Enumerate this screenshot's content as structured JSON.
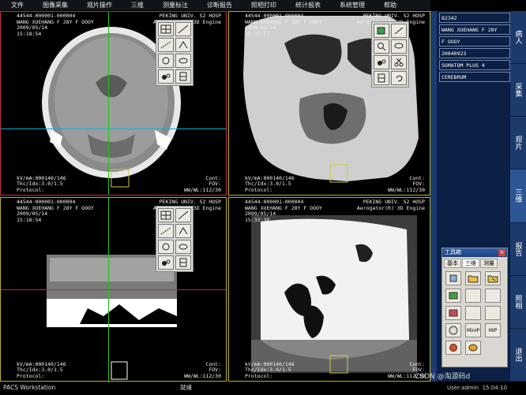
{
  "menu": [
    "文件",
    "图像采集",
    "观片操作",
    "三维",
    "测量标注",
    "诊断报告",
    "照相打印",
    "统计报表",
    "系统管理",
    "帮助"
  ],
  "viewports": [
    {
      "tl": "44544-000001-000004\nWANG XUEHANG F 28Y F OOOY\n2009/05/14\n15:18:54",
      "tr": "PEKING UNIV. S2 HOSP\nAerogator(R) 3D Engine",
      "bl": "kV/mA:000140/146\nThc/Idx:3.0/1.5\nProtocol:",
      "br": "Cont:\nFOV:\nWW/WL:112/30"
    },
    {
      "tl": "44544-000001-000004\nWANG XUEHANG F 28Y F OOOY\n2009/05/14\n15:33:57",
      "tr": "PEKING UNIV. S2 HOSP\nAerogator(R) 3D Engine",
      "bl": "kV/mA:000140/146\nThc/Idx:3.0/1.5\nProtocol:",
      "br": "Cont:\nFOV:\nWW/WL:112/30"
    },
    {
      "tl": "44544-000001-000004\nWANG XUEHANG F 28Y F OOOY\n2009/05/14\n15:18:54",
      "tr": "PEKING UNIV. S2 HOSP\nAerogator(R) 3D Engine",
      "bl": "kV/mA:000140/146\nThc/Idx:3.0/1.5\nProtocol:",
      "br": "Cont:\nFOV:\nWW/WL:112/30"
    },
    {
      "tl": "44544-000001-000004\nWANG XUEHANG F 28Y F OOOY\n2009/05/14\n15:33:38",
      "tr": "PEKING UNIV. S2 HOSP\nAerogator(R) 3D Engine",
      "bl": "kV/mA:000140/146\nThc/Idx:3.0/1.5\nProtocol:",
      "br": "Cont:\nFOV:\nWW/WL:112/30"
    }
  ],
  "patient_info": [
    "82342",
    "WANG XUEHANG F 28Y",
    "F OOOY",
    "20040923",
    "SOMATOM PLUS 4",
    "CEREBRUM"
  ],
  "side_nav": [
    "病人",
    "采集",
    "观片",
    "三维",
    "报告",
    "照相",
    "退出"
  ],
  "side_nav_active": "三维",
  "toolbox": {
    "title": "工具箱",
    "close": "×",
    "tabs": [
      "基本",
      "三维",
      "测量"
    ],
    "active_tab": "三维",
    "mip_labels": [
      "MinIP",
      "MIP"
    ]
  },
  "status": {
    "app": "PACS Workstation",
    "state": "就绪",
    "user": "User:admin",
    "time": "15:04:10"
  },
  "watermark": "CSDN @淘源码d",
  "colors": {
    "crosshair_h": "#00b8d8",
    "crosshair_v": "#22c020",
    "selected_border": "#c03040",
    "border": "#b8b020",
    "sidebar_bg": "#0b2044"
  }
}
